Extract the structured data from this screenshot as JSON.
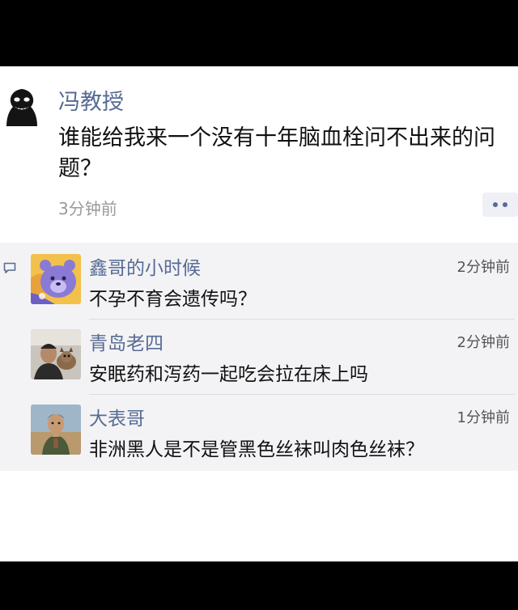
{
  "post": {
    "author": "冯教授",
    "text": "谁能给我来一个没有十年脑血栓问不出来的问题？",
    "time": "3分钟前",
    "avatar_icon": "dark-face-avatar",
    "more_icon": "more-dots-icon"
  },
  "comments": [
    {
      "name": "鑫哥的小时候",
      "time": "2分钟前",
      "text": "不孕不育会遗传吗？",
      "avatar_icon": "purple-bear-avatar"
    },
    {
      "name": "青岛老四",
      "time": "2分钟前",
      "text": "安眠药和泻药一起吃会拉在床上吗",
      "avatar_icon": "man-with-dog-avatar"
    },
    {
      "name": "大表哥",
      "time": "1分钟前",
      "text": "非洲黑人是不是管黑色丝袜叫肉色丝袜？",
      "avatar_icon": "child-photo-avatar"
    }
  ],
  "colors": {
    "name_blue": "#576b95",
    "comments_bg": "#f3f3f5"
  }
}
